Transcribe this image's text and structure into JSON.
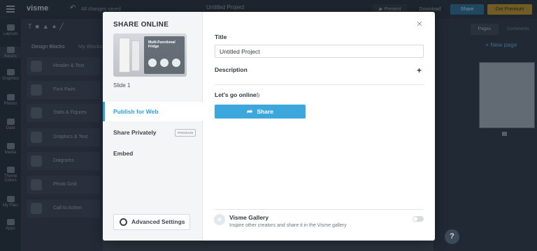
{
  "app": {
    "logo": "visme",
    "save_status": "All changes saved",
    "project_title": "Untitled Project",
    "present_label": "Present",
    "download_label": "Download",
    "share_label": "Share",
    "premium_label": "Get Premium"
  },
  "rail": [
    {
      "label": "Layouts",
      "icon": "layout-icon"
    },
    {
      "label": "Basics",
      "icon": "shapes-icon"
    },
    {
      "label": "Graphics",
      "icon": "graphics-icon"
    },
    {
      "label": "Photos",
      "icon": "photo-icon"
    },
    {
      "label": "Data",
      "icon": "chart-icon"
    },
    {
      "label": "Media",
      "icon": "media-icon"
    },
    {
      "label": "Theme Colors",
      "icon": "palette-icon"
    },
    {
      "label": "My Files",
      "icon": "folder-icon"
    },
    {
      "label": "Apps",
      "icon": "apps-icon"
    }
  ],
  "blocks": {
    "tabs": [
      "Design Blocks",
      "My Blocks"
    ],
    "items": [
      "Header & Text",
      "Font Pairs",
      "Stats & Figures",
      "Graphics & Text",
      "Diagrams",
      "Photo Grid",
      "Call to Action"
    ]
  },
  "right_panel": {
    "tabs": [
      "Pages",
      "Comments"
    ],
    "new_page": "+ New page"
  },
  "modal": {
    "title": "SHARE ONLINE",
    "thumbnail_heading": "Multi-Functional Fridge",
    "slide_label": "Slide 1",
    "nav": [
      {
        "label": "Publish for Web",
        "active": true
      },
      {
        "label": "Share Privately",
        "badge": "PREMIUM"
      },
      {
        "label": "Embed"
      }
    ],
    "advanced_settings": "Advanced Settings",
    "title_label": "Title",
    "title_value": "Untitled Project",
    "description_label": "Description",
    "lets_go_label": "Let's go online!",
    "share_button": "Share",
    "gallery_title": "Visme Gallery",
    "gallery_subtitle": "Inspire other creators and share it in the Visme gallery",
    "gallery_enabled": false
  },
  "help_label": "?",
  "colors": {
    "accent": "#3ba7dc",
    "premium": "#f3b431",
    "topbar": "#26313c"
  }
}
